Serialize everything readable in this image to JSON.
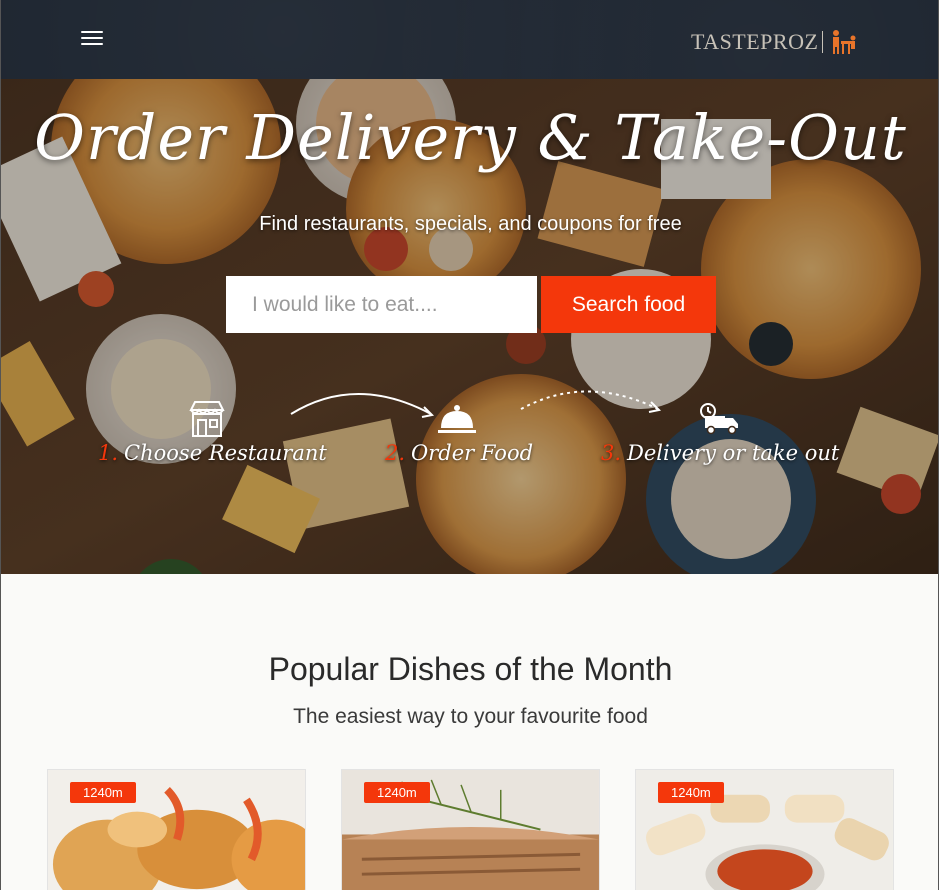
{
  "navbar": {
    "menu_icon": "hamburger-menu-icon",
    "logo_text": "TASTEPROZ"
  },
  "hero": {
    "title": "Order Delivery & Take-Out",
    "subtitle": "Find restaurants, specials, and coupons for free",
    "search": {
      "placeholder": "I would like to eat....",
      "value": "",
      "button_label": "Search food"
    },
    "steps": [
      {
        "number": "1.",
        "label": "Choose Restaurant",
        "icon": "storefront-icon"
      },
      {
        "number": "2.",
        "label": "Order Food",
        "icon": "cloche-icon"
      },
      {
        "number": "3.",
        "label": "Delivery or take out",
        "icon": "delivery-truck-icon"
      }
    ]
  },
  "popular": {
    "title": "Popular Dishes of the Month",
    "subtitle": "The easiest way to your favourite food",
    "cards": [
      {
        "distance": "1240m",
        "image": "fried-shrimp"
      },
      {
        "distance": "1240m",
        "image": "grilled-fish-with-dill"
      },
      {
        "distance": "1240m",
        "image": "wraps-with-sauce"
      }
    ]
  },
  "colors": {
    "accent": "#f4370b",
    "navbar": "#1d2530",
    "logo": "#c7c2b8"
  }
}
